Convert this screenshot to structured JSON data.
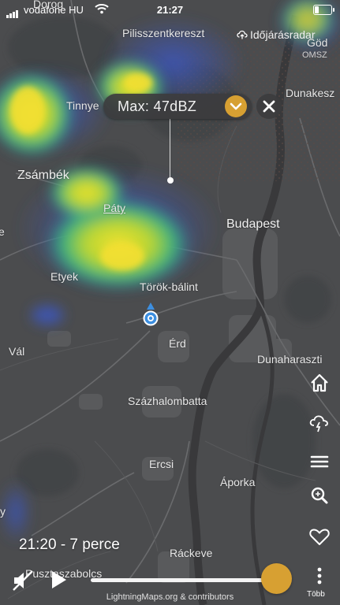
{
  "status_bar": {
    "carrier": "vodafone HU",
    "time": "21:27"
  },
  "radar_link": {
    "label": "Időjárásradar",
    "source": "OMSZ"
  },
  "max_popup": {
    "label": "Max: 47dBZ"
  },
  "places": {
    "pilisszentkereszt": "Pilisszentkereszt",
    "dorog": "Dorog",
    "god": "Göd",
    "dunakeszi": "Dunakesz",
    "tinnye": "Tinnye",
    "zsambek": "Zsámbék",
    "paty": "Páty",
    "budapest": "Budapest",
    "etyek": "Etyek",
    "torokbalint": "Török-bálint",
    "erd": "Érd",
    "val": "Vál",
    "dunaharaszti": "Dunaharaszti",
    "szazhalombatta": "Százhalombatta",
    "ercsi": "Ercsi",
    "aporka": "Áporka",
    "rackeve": "Ráckeve",
    "pusztaszabolcs": "Pusztaszabolcs",
    "e_edge": "e",
    "y_edge": "y"
  },
  "playback": {
    "time_label": "21:20 - 7 perce",
    "progress": 1.0
  },
  "side_menu": {
    "more_label": "Több"
  },
  "attribution": "LightningMaps.org & contributors",
  "colors": {
    "accent": "#d7a032",
    "map_bg": "#4a4b4d",
    "location": "#3d8fe0"
  },
  "icons": [
    "home-icon",
    "storm-cloud-icon",
    "menu-icon",
    "search-icon",
    "heart-icon",
    "more-icon",
    "sound-off-icon",
    "play-icon",
    "chevron-down-icon",
    "close-icon",
    "location-icon",
    "cloud-upload-icon"
  ]
}
